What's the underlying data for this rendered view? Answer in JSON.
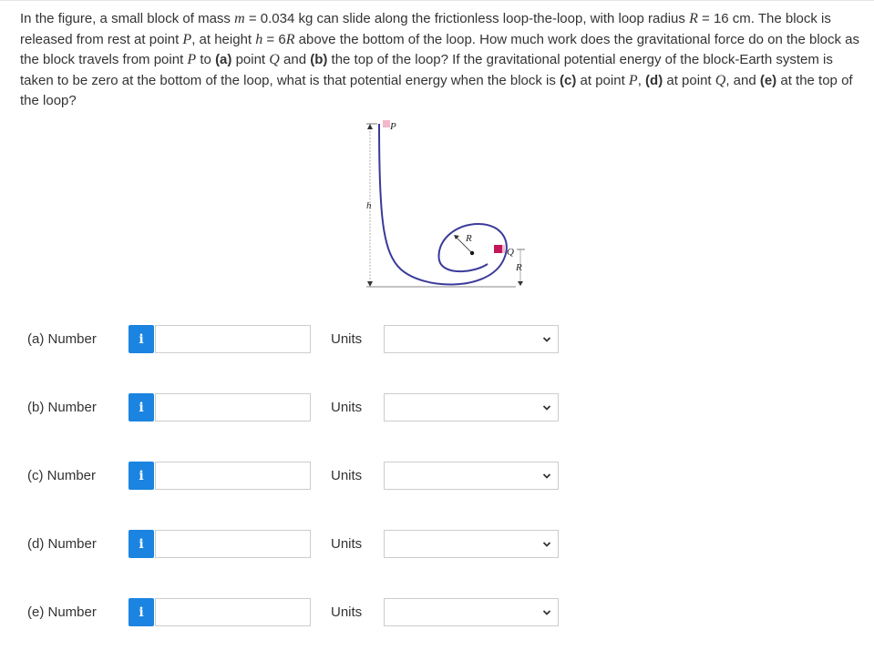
{
  "question": {
    "line1_a": "In the figure, a small block of mass ",
    "m_var": "m",
    "line1_b": " = 0.034 kg can slide along the frictionless loop-the-loop, with loop radius ",
    "R_var": "R",
    "line1_c": " = 16 cm. The block is released from rest at point ",
    "P1": "P",
    "line1_d": ", at height ",
    "h_var": "h",
    "line1_e": " = 6",
    "R_var2": "R",
    "line1_f": " above the bottom of the loop. How much work does the gravitational force do on the block as the block travels from point ",
    "P2": "P",
    "line1_g": " to ",
    "a_tag": "(a)",
    "line1_h": " point ",
    "Q1": "Q",
    "line1_i": " and ",
    "b_tag": "(b)",
    "line1_j": " the top of the loop? If the gravitational potential energy of the block-Earth system is taken to be zero at the bottom of the loop, what is that potential energy when the block is ",
    "c_tag": "(c)",
    "line1_k": " at point ",
    "P3": "P",
    "line1_l": ", ",
    "d_tag": "(d)",
    "line1_m": " at point ",
    "Q2": "Q",
    "line1_n": ", and ",
    "e_tag": "(e)",
    "line1_o": " at the top of the loop?"
  },
  "figure": {
    "label_P": "P",
    "label_h": "h",
    "label_R_loop": "R",
    "label_Q": "Q",
    "label_R_side": "R",
    "track_color": "#3a3a9a",
    "block_color": "#c2185b"
  },
  "parts": [
    {
      "label": "(a)  Number",
      "info": "i",
      "value": "",
      "units_label": "Units",
      "units_value": ""
    },
    {
      "label": "(b)  Number",
      "info": "i",
      "value": "",
      "units_label": "Units",
      "units_value": ""
    },
    {
      "label": "(c)  Number",
      "info": "i",
      "value": "",
      "units_label": "Units",
      "units_value": ""
    },
    {
      "label": "(d)  Number",
      "info": "i",
      "value": "",
      "units_label": "Units",
      "units_value": ""
    },
    {
      "label": "(e)  Number",
      "info": "i",
      "value": "",
      "units_label": "Units",
      "units_value": ""
    }
  ],
  "colors": {
    "info_button": "#1a84e0",
    "input_border": "#cccccc",
    "text": "#333333"
  }
}
